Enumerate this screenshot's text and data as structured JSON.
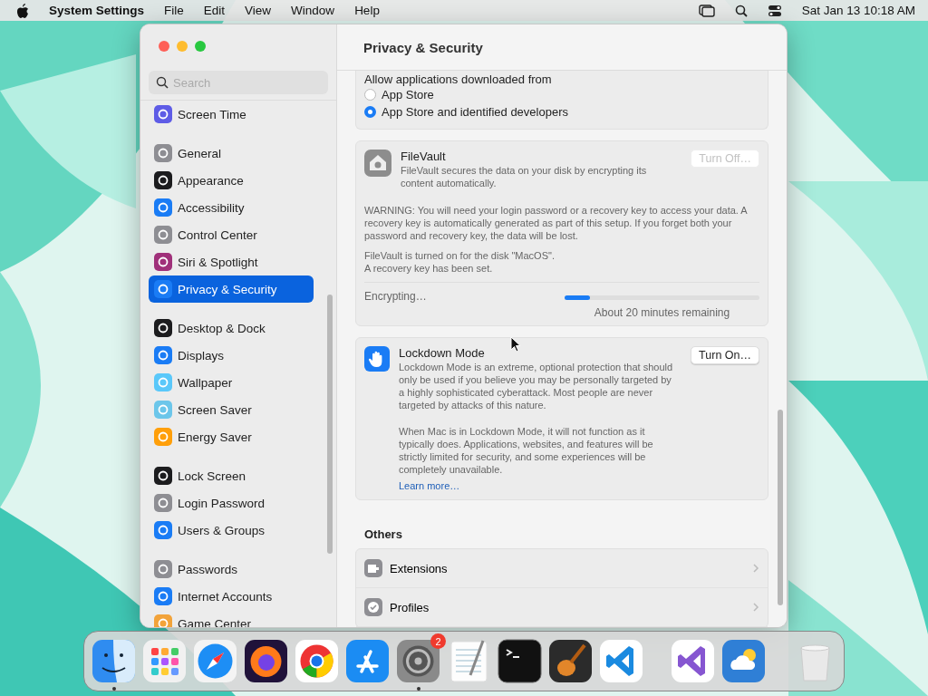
{
  "menu_bar": {
    "app": "System Settings",
    "menus": [
      "File",
      "Edit",
      "View",
      "Window",
      "Help"
    ],
    "clock": "Sat Jan 13  10:18 AM"
  },
  "window": {
    "title": "Privacy & Security"
  },
  "sidebar": {
    "search": {
      "placeholder": "Search"
    },
    "groups": [
      [
        {
          "label": "Screen Time",
          "color": "#5e5ce6",
          "selected": false
        }
      ],
      [
        {
          "label": "General",
          "color": "#8e8e93",
          "selected": false
        },
        {
          "label": "Appearance",
          "color": "#1c1c1e",
          "selected": false
        },
        {
          "label": "Accessibility",
          "color": "#1a7cf5",
          "selected": false
        },
        {
          "label": "Control Center",
          "color": "#8e8e93",
          "selected": false
        },
        {
          "label": "Siri & Spotlight",
          "color": "#a0307a",
          "selected": false
        },
        {
          "label": "Privacy & Security",
          "color": "#1a7cf5",
          "selected": true
        }
      ],
      [
        {
          "label": "Desktop & Dock",
          "color": "#1c1c1e",
          "selected": false
        },
        {
          "label": "Displays",
          "color": "#1a7cf5",
          "selected": false
        },
        {
          "label": "Wallpaper",
          "color": "#5ac8fa",
          "selected": false
        },
        {
          "label": "Screen Saver",
          "color": "#6cc6ea",
          "selected": false
        },
        {
          "label": "Energy Saver",
          "color": "#ff9f0a",
          "selected": false
        }
      ],
      [
        {
          "label": "Lock Screen",
          "color": "#1c1c1e",
          "selected": false
        },
        {
          "label": "Login Password",
          "color": "#8e8e93",
          "selected": false
        },
        {
          "label": "Users & Groups",
          "color": "#1a7cf5",
          "selected": false
        }
      ],
      [
        {
          "label": "Passwords",
          "color": "#8e8e93",
          "selected": false
        },
        {
          "label": "Internet Accounts",
          "color": "#1a7cf5",
          "selected": false
        },
        {
          "label": "Game Center",
          "color": "#f2a33a",
          "selected": false
        }
      ]
    ]
  },
  "allow_downloads": {
    "label": "Allow applications downloaded from",
    "options": [
      {
        "label": "App Store",
        "selected": false
      },
      {
        "label": "App Store and identified developers",
        "selected": true
      }
    ]
  },
  "filevault": {
    "title": "FileVault",
    "description": "FileVault secures the data on your disk by encrypting its content automatically.",
    "button": {
      "label": "Turn Off…",
      "disabled": true
    },
    "warning": "WARNING: You will need your login password or a recovery key to access your data. A recovery key is automatically generated as part of this setup. If you forget both your password and recovery key, the data will be lost.",
    "status": [
      "FileVault is turned on for the disk \"MacOS\".",
      "A recovery key has been set."
    ],
    "progress": {
      "label": "Encrypting…",
      "level": 0.13,
      "remaining": "About 20 minutes remaining"
    }
  },
  "lockdown": {
    "title": "Lockdown Mode",
    "button": {
      "label": "Turn On…",
      "disabled": false
    },
    "paragraphs": [
      "Lockdown Mode is an extreme, optional protection that should only be used if you believe you may be personally targeted by a highly sophisticated cyberattack. Most people are never targeted by attacks of this nature.",
      "When Mac is in Lockdown Mode, it will not function as it typically does. Applications, websites, and features will be strictly limited for security, and some experiences will be completely unavailable."
    ],
    "link": "Learn more…"
  },
  "others": {
    "title": "Others",
    "items": [
      {
        "label": "Extensions",
        "kind": "extensions"
      },
      {
        "label": "Profiles",
        "kind": "profiles"
      }
    ]
  },
  "dock": {
    "apps": [
      {
        "kind": "finder",
        "running": true
      },
      {
        "kind": "launchpad"
      },
      {
        "kind": "safari"
      },
      {
        "kind": "firefox"
      },
      {
        "kind": "chrome"
      },
      {
        "kind": "appstore"
      },
      {
        "kind": "settings",
        "running": true,
        "badge": "2"
      },
      {
        "kind": "textedit"
      },
      {
        "kind": "terminal"
      },
      {
        "kind": "garageband"
      },
      {
        "kind": "vscode"
      },
      {
        "kind": "divider"
      },
      {
        "kind": "vstudio"
      },
      {
        "kind": "weather"
      },
      {
        "kind": "divider"
      },
      {
        "kind": "trash"
      }
    ]
  }
}
